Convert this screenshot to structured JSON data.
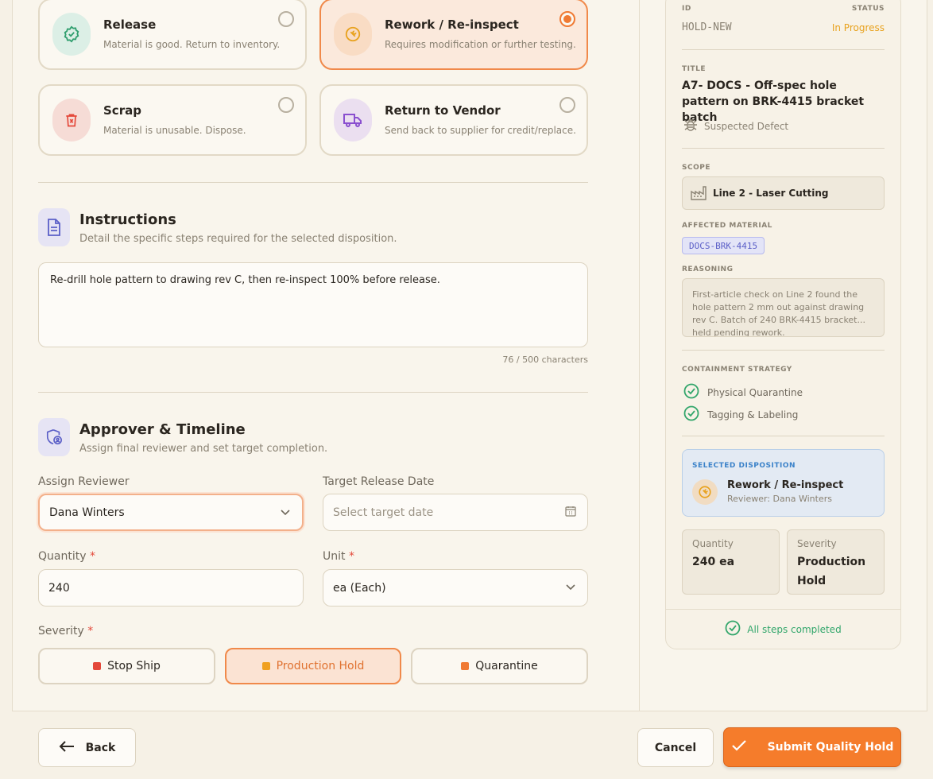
{
  "disposition": {
    "options": [
      {
        "title": "Release",
        "subtitle": "Material is good. Return to inventory.",
        "icon": "badge-check-icon",
        "selected": false
      },
      {
        "title": "Rework / Re-inspect",
        "subtitle": "Requires modification or further testing.",
        "icon": "wrench-icon",
        "selected": true
      },
      {
        "title": "Scrap",
        "subtitle": "Material is unusable. Dispose.",
        "icon": "trash-icon",
        "selected": false
      },
      {
        "title": "Return to Vendor",
        "subtitle": "Send back to supplier for credit/replace.",
        "icon": "truck-icon",
        "selected": false
      }
    ]
  },
  "instructions": {
    "title": "Instructions",
    "subtitle": "Detail the specific steps required for the selected disposition.",
    "value": "Re-drill hole pattern to drawing rev C, then re-inspect 100% before release.",
    "counter": "76 / 500 characters"
  },
  "approver": {
    "title": "Approver & Timeline",
    "subtitle": "Assign final reviewer and set target completion.",
    "reviewer_label": "Assign Reviewer",
    "reviewer_value": "Dana Winters",
    "date_label": "Target Release Date",
    "date_placeholder": "Select target date",
    "quantity_label": "Quantity",
    "quantity_value": "240",
    "unit_label": "Unit",
    "unit_value": "ea (Each)",
    "severity_label": "Severity",
    "required_mark": "*",
    "severity_options": [
      {
        "label": "Stop Ship",
        "color": "#e4483a",
        "selected": false
      },
      {
        "label": "Production Hold",
        "color": "#f0a020",
        "selected": true
      },
      {
        "label": "Quarantine",
        "color": "#f07a33",
        "selected": false
      }
    ]
  },
  "summary": {
    "id_label": "ID",
    "id_value": "HOLD-NEW",
    "status_label": "STATUS",
    "status_value": "In Progress",
    "title_label": "TITLE",
    "title_value": "A7- DOCS - Off-spec hole pattern on BRK-4415 bracket batch",
    "type_value": "Suspected Defect",
    "scope_label": "SCOPE",
    "scope_value": "Line 2 - Laser Cutting",
    "material_label": "AFFECTED MATERIAL",
    "material_value": "DOCS-BRK-4415",
    "reasoning_label": "REASONING",
    "reasoning_value": "First-article check on Line 2 found the hole pattern 2 mm out against drawing rev C. Batch of 240 BRK-4415 bracket... held pending rework.",
    "containment_label": "CONTAINMENT STRATEGY",
    "containment_items": [
      "Physical Quarantine",
      "Tagging & Labeling"
    ],
    "selected_label": "SELECTED DISPOSITION",
    "selected_title": "Rework / Re-inspect",
    "selected_reviewer": "Reviewer: Dana Winters",
    "quantity_label": "Quantity",
    "quantity_value": "240 ea",
    "severity_label": "Severity",
    "severity_value": "Production Hold",
    "footer_status": "All steps completed"
  },
  "footer": {
    "back_label": "Back",
    "cancel_label": "Cancel",
    "submit_label": "Submit Quality Hold"
  },
  "colors": {
    "accent": "#f57c2b",
    "success": "#32a66b",
    "status_in_progress": "#e8a21e"
  }
}
